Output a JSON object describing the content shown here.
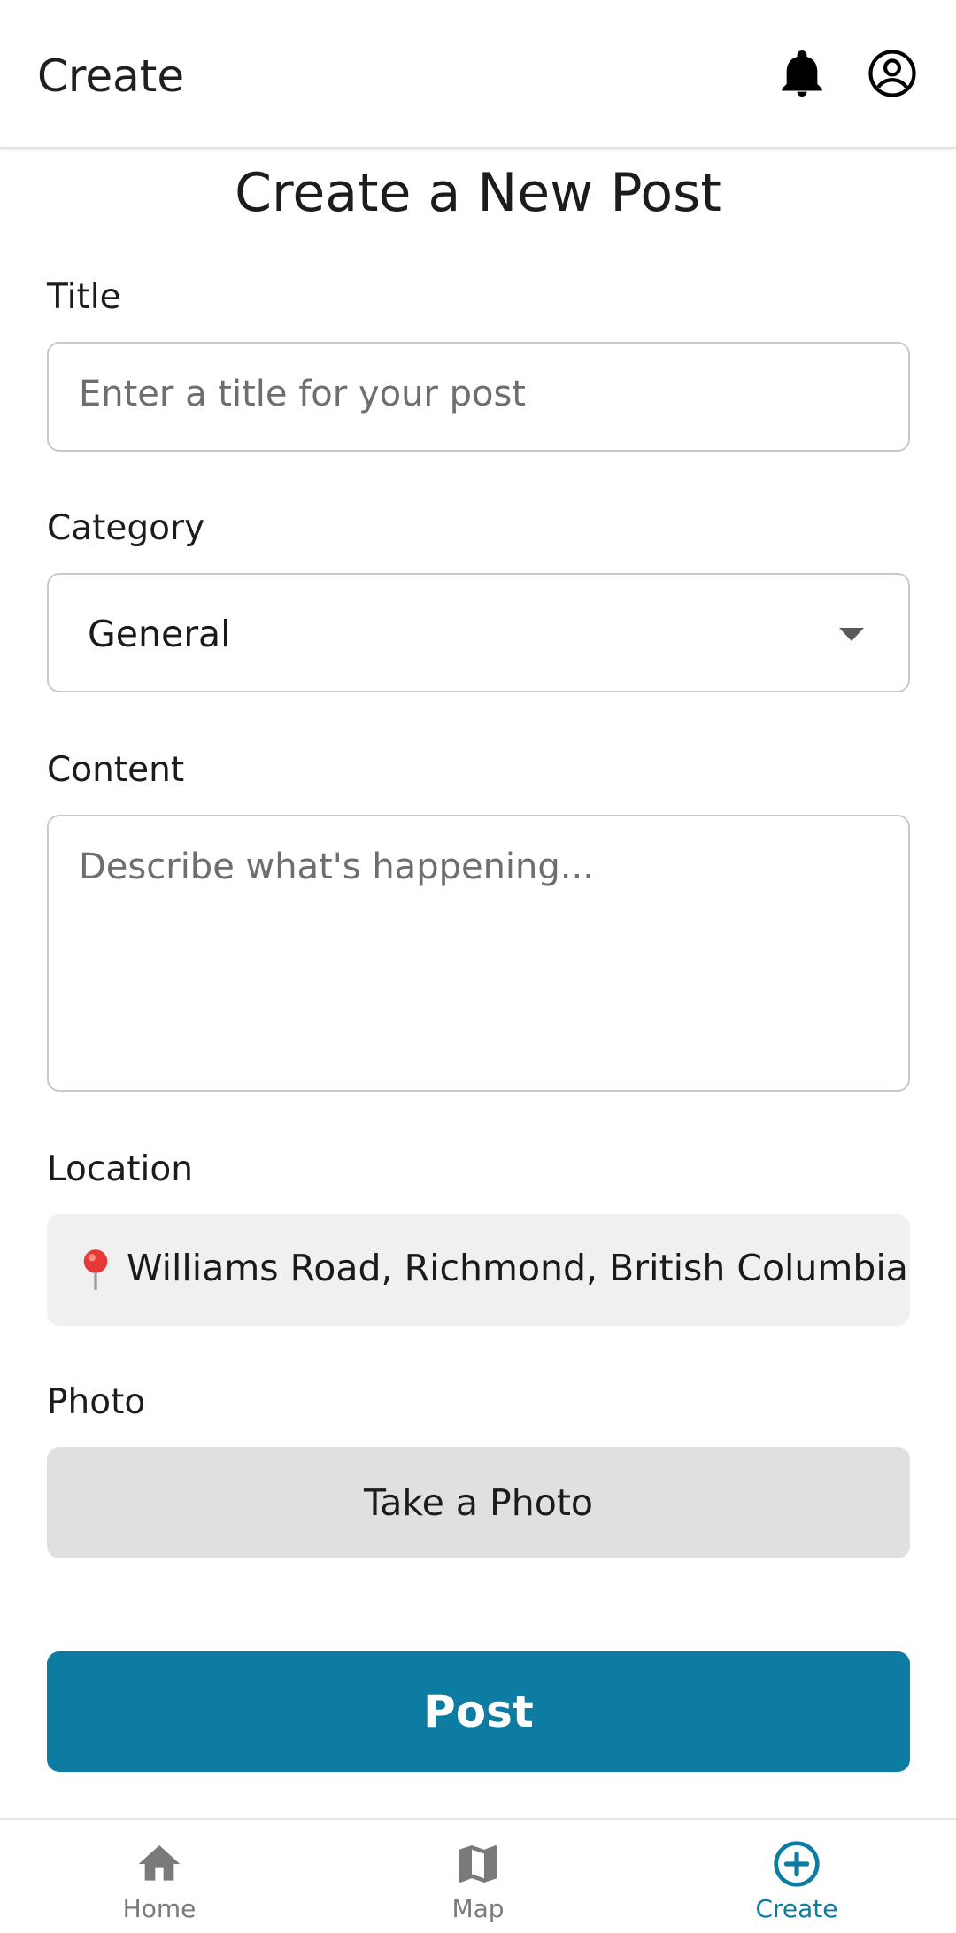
{
  "appbar": {
    "title": "Create",
    "icons": [
      "bell-icon",
      "account-circle-icon"
    ]
  },
  "form": {
    "heading": "Create a New Post",
    "title": {
      "label": "Title",
      "value": "",
      "placeholder": "Enter a title for your post"
    },
    "category": {
      "label": "Category",
      "selected": "General"
    },
    "content": {
      "label": "Content",
      "value": "",
      "placeholder": "Describe what's happening..."
    },
    "location": {
      "label": "Location",
      "icon": "map-pin-icon",
      "value": "Williams Road, Richmond, British Columbia"
    },
    "photo": {
      "label": "Photo",
      "button_label": "Take a Photo"
    },
    "submit_label": "Post"
  },
  "bottom_nav": {
    "items": [
      {
        "label": "Home",
        "icon": "home-icon",
        "active": false
      },
      {
        "label": "Map",
        "icon": "map-icon",
        "active": false
      },
      {
        "label": "Create",
        "icon": "add-circle-icon",
        "active": true
      }
    ]
  },
  "colors": {
    "accent": "#0c7ca3",
    "input_border": "#c9c9c9",
    "location_bg": "#f0f0f0",
    "photo_button_bg": "#e0e0e0",
    "inactive_nav": "#7a7a7a"
  }
}
